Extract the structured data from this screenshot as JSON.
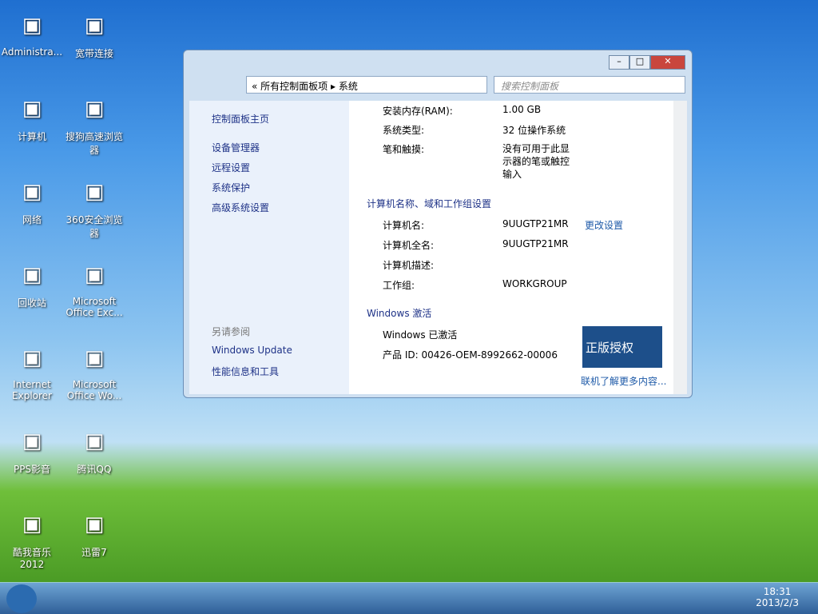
{
  "desktop": [
    "Administra...",
    "宽带连接",
    "计算机",
    "搜狗高速浏览器",
    "网络",
    "360安全浏览器",
    "回收站",
    "Microsoft Office Exc...",
    "Internet Explorer",
    "Microsoft Office Wo...",
    "PPS影音",
    "腾讯QQ",
    "酷我音乐 2012",
    "迅雷7"
  ],
  "window": {
    "bc1": "所有控制面板项",
    "bc2": "系统",
    "search": "搜索控制面板"
  },
  "left": {
    "home": "控制面板主页",
    "l1": "设备管理器",
    "l2": "远程设置",
    "l3": "系统保护",
    "l4": "高级系统设置",
    "see": "另请参阅",
    "wu": "Windows Update",
    "pi": "性能信息和工具"
  },
  "main": {
    "ram_l": "安装内存(RAM):",
    "ram_v": "1.00 GB",
    "type_l": "系统类型:",
    "type_v": "32 位操作系统",
    "pen_l": "笔和触摸:",
    "pen_v": "没有可用于此显示器的笔或触控输入",
    "sec1": "计算机名称、域和工作组设置",
    "cn_l": "计算机名:",
    "cn_v": "9UUGTP21MR",
    "chg": "更改设置",
    "fcn_l": "计算机全名:",
    "fcn_v": "9UUGTP21MR",
    "desc_l": "计算机描述:",
    "wg_l": "工作组:",
    "wg_v": "WORKGROUP",
    "sec2": "Windows 激活",
    "act": "Windows 已激活",
    "pid": "产品 ID: 00426-OEM-8992662-00006",
    "badge": "正版授权",
    "more": "联机了解更多内容..."
  },
  "taskbar": {
    "time": "18:31",
    "date": "2013/2/3"
  }
}
